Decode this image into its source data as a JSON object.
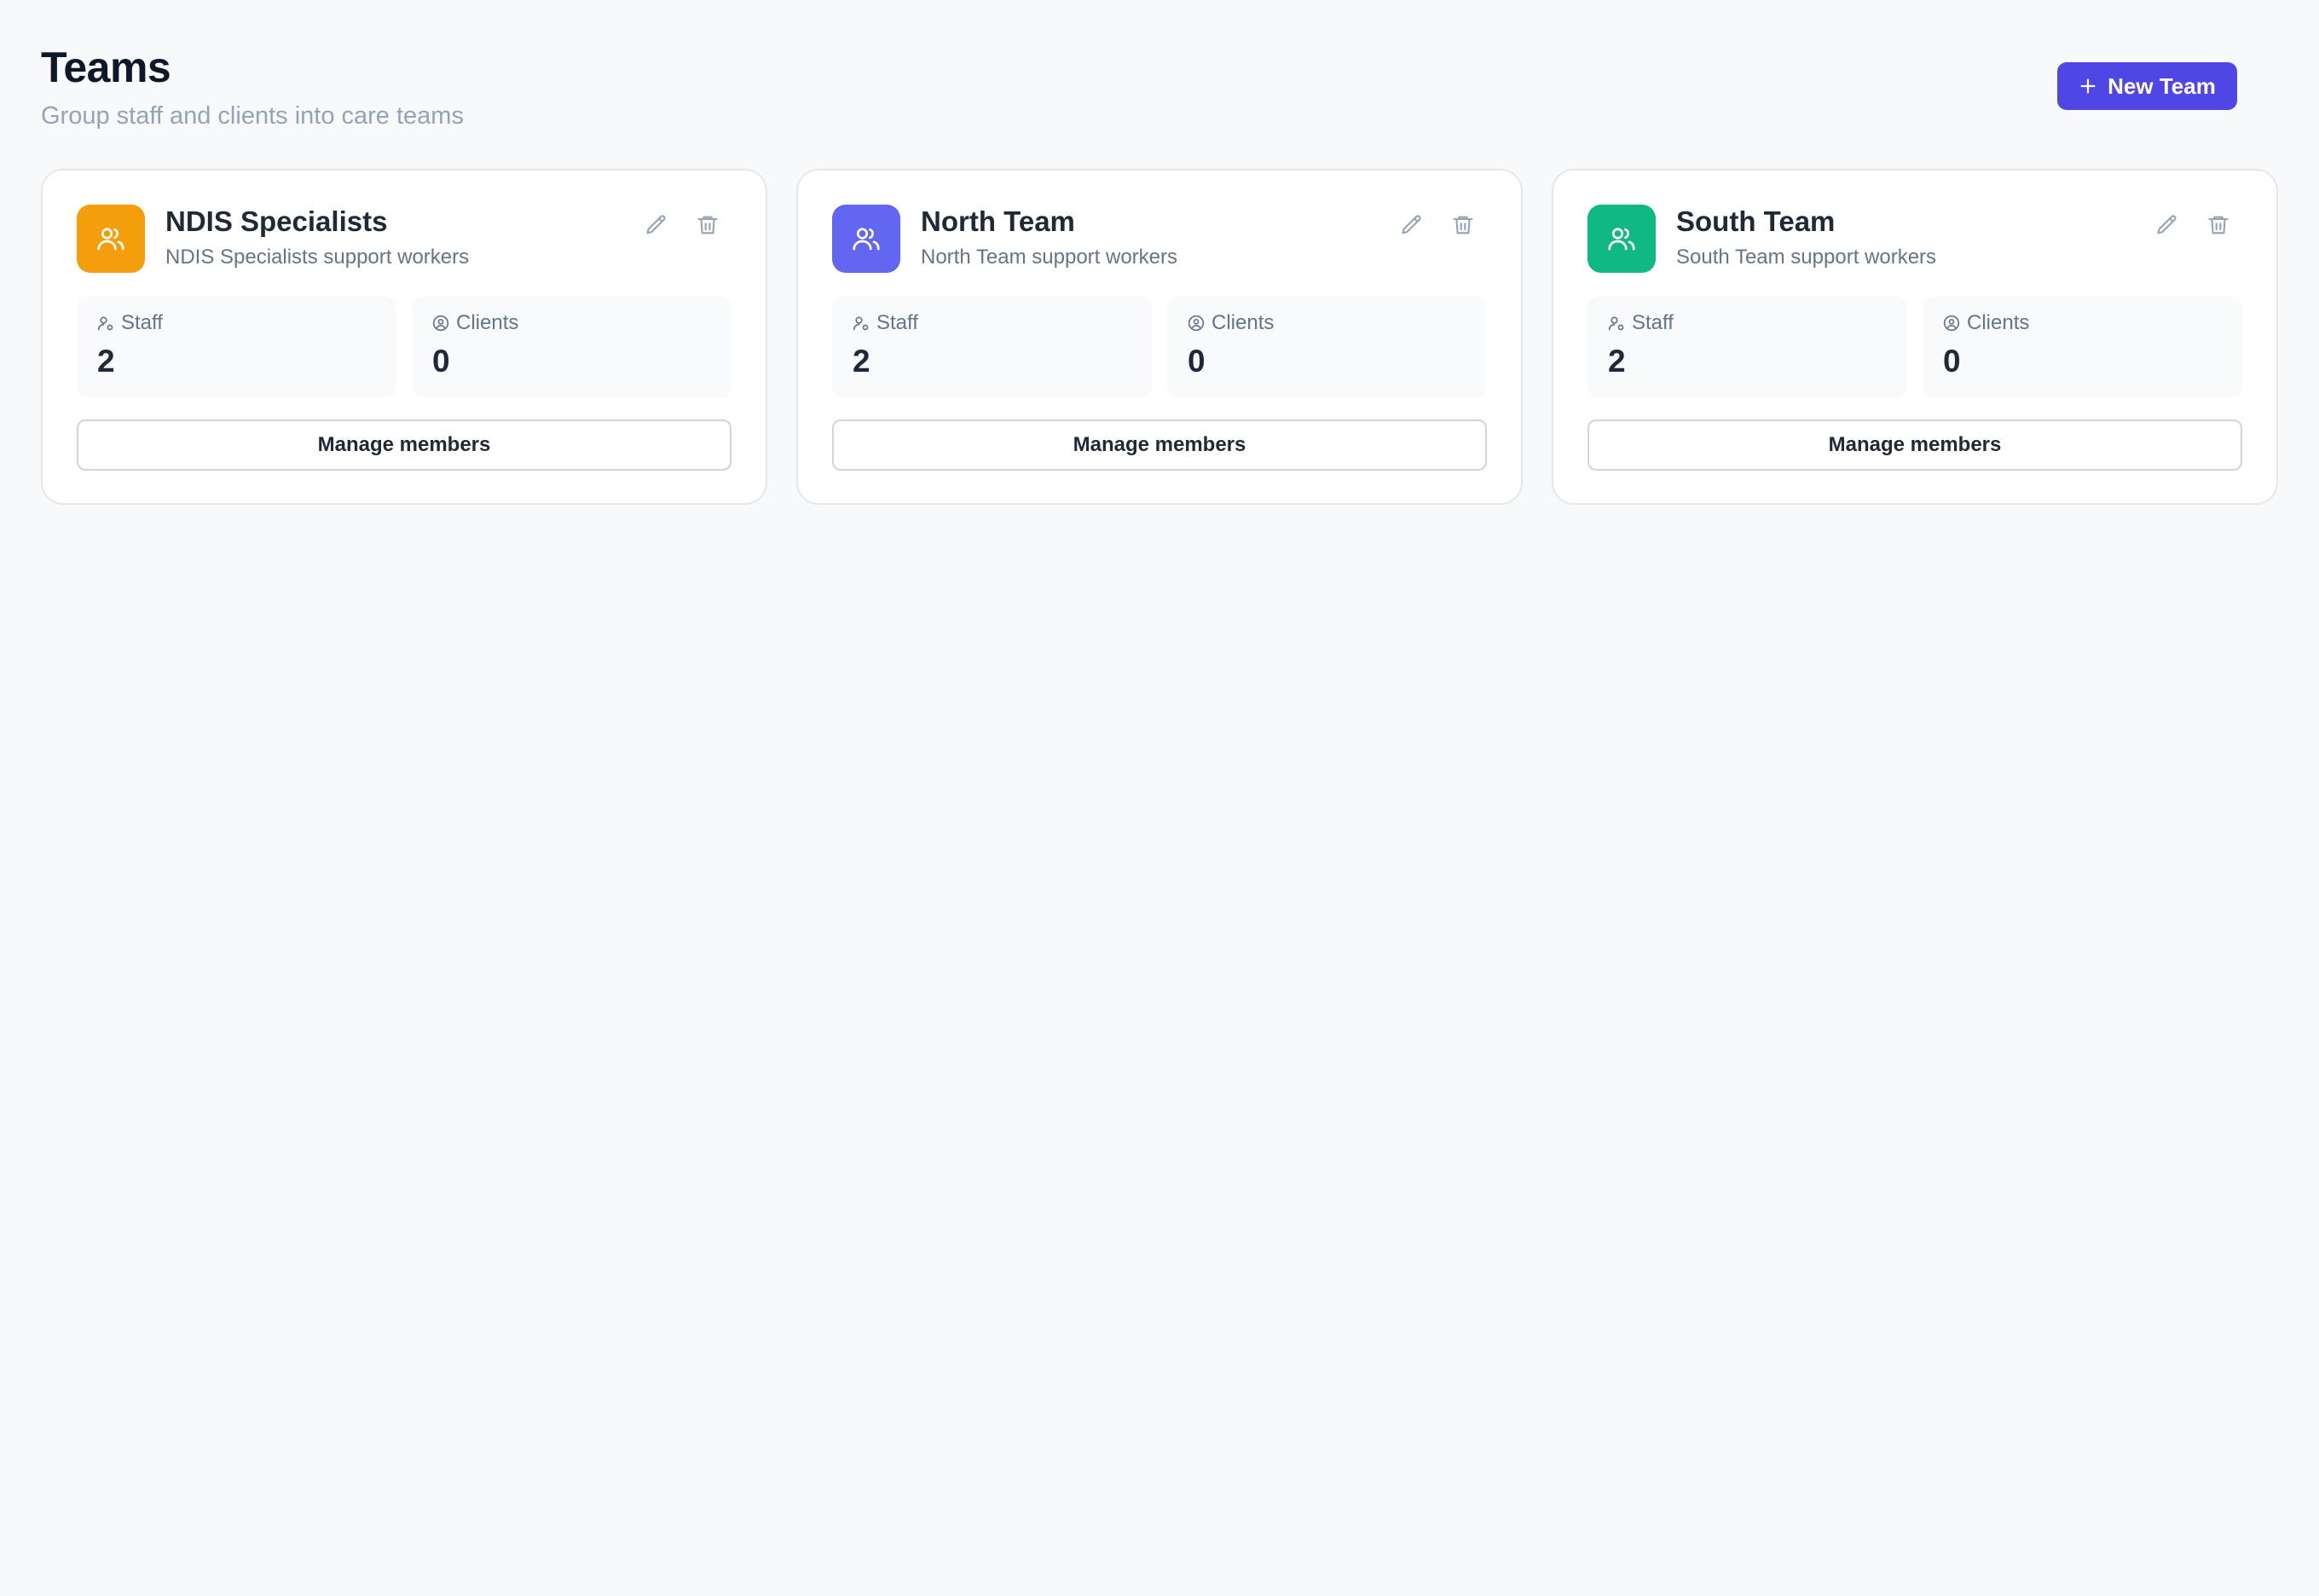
{
  "header": {
    "title": "Teams",
    "subtitle": "Group staff and clients into care teams",
    "new_team_label": "New Team"
  },
  "labels": {
    "staff": "Staff",
    "clients": "Clients",
    "manage_members": "Manage members"
  },
  "teams": [
    {
      "name": "NDIS Specialists",
      "description": "NDIS Specialists support workers",
      "color": "#f59e0b",
      "staff_count": "2",
      "clients_count": "0"
    },
    {
      "name": "North Team",
      "description": "North Team support workers",
      "color": "#6366f1",
      "staff_count": "2",
      "clients_count": "0"
    },
    {
      "name": "South Team",
      "description": "South Team support workers",
      "color": "#10b981",
      "staff_count": "2",
      "clients_count": "0"
    }
  ],
  "icons": {
    "new_team": "plus-icon",
    "avatar": "users-icon",
    "edit": "pencil-icon",
    "delete": "trash-icon",
    "staff": "user-cog-icon",
    "clients": "circle-user-icon"
  }
}
